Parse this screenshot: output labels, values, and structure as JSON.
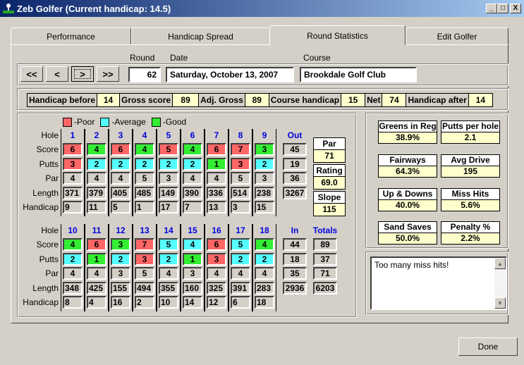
{
  "window": {
    "title": "Zeb Golfer (Current handicap: 14.5)",
    "minimize": "_",
    "maximize": "□",
    "close": "X"
  },
  "tabs": [
    {
      "label": "Performance",
      "active": false
    },
    {
      "label": "Handicap Spread",
      "active": false
    },
    {
      "label": "Round Statistics",
      "active": true
    },
    {
      "label": "Edit Golfer",
      "active": false
    }
  ],
  "nav": {
    "first": "<<",
    "prev": "<",
    "next": ">",
    "last": ">>"
  },
  "round": {
    "round_label": "Round",
    "round": "62",
    "date_label": "Date",
    "date": "Saturday, October 13, 2007",
    "course_label": "Course",
    "course": "Brookdale Golf Club"
  },
  "summary": [
    {
      "label": "Handicap before",
      "value": "14"
    },
    {
      "label": "Gross score",
      "value": "89"
    },
    {
      "label": "Adj. Gross",
      "value": "89"
    },
    {
      "label": "Course handicap",
      "value": "15"
    },
    {
      "label": "Net",
      "value": "74"
    },
    {
      "label": "Handicap after",
      "value": "14"
    }
  ],
  "legend": [
    {
      "label": "-Poor",
      "color": "#ff6666"
    },
    {
      "label": "-Average",
      "color": "#55ffff"
    },
    {
      "label": "-Good",
      "color": "#33ee33"
    }
  ],
  "row_labels": [
    "Hole",
    "Score",
    "Putts",
    "Par",
    "Length",
    "Handicap"
  ],
  "front": {
    "holes": [
      "1",
      "2",
      "3",
      "4",
      "5",
      "6",
      "7",
      "8",
      "9"
    ],
    "score": [
      "6",
      "4",
      "6",
      "4",
      "5",
      "4",
      "6",
      "7",
      "3"
    ],
    "score_rating": [
      "poor",
      "good",
      "poor",
      "good",
      "poor",
      "good",
      "poor",
      "poor",
      "good"
    ],
    "putts": [
      "3",
      "2",
      "2",
      "2",
      "2",
      "2",
      "1",
      "3",
      "2"
    ],
    "putts_rating": [
      "poor",
      "avg",
      "avg",
      "avg",
      "avg",
      "avg",
      "good",
      "poor",
      "avg"
    ],
    "par": [
      "4",
      "4",
      "4",
      "5",
      "3",
      "4",
      "4",
      "5",
      "3"
    ],
    "length": [
      "371",
      "379",
      "405",
      "485",
      "149",
      "390",
      "336",
      "514",
      "238"
    ],
    "handicap": [
      "9",
      "11",
      "5",
      "1",
      "17",
      "7",
      "13",
      "3",
      "15"
    ],
    "sum_label": "Out",
    "sums": [
      "45",
      "19",
      "36",
      "3267"
    ]
  },
  "back": {
    "holes": [
      "10",
      "11",
      "12",
      "13",
      "14",
      "15",
      "16",
      "17",
      "18"
    ],
    "score": [
      "4",
      "6",
      "3",
      "7",
      "5",
      "4",
      "6",
      "5",
      "4"
    ],
    "score_rating": [
      "good",
      "poor",
      "good",
      "poor",
      "avg",
      "avg",
      "poor",
      "avg",
      "good"
    ],
    "putts": [
      "2",
      "1",
      "2",
      "3",
      "2",
      "1",
      "3",
      "2",
      "2"
    ],
    "putts_rating": [
      "avg",
      "good",
      "avg",
      "poor",
      "avg",
      "good",
      "poor",
      "avg",
      "avg"
    ],
    "par": [
      "4",
      "4",
      "3",
      "5",
      "4",
      "3",
      "4",
      "4",
      "4"
    ],
    "length": [
      "348",
      "425",
      "155",
      "494",
      "355",
      "160",
      "325",
      "391",
      "283"
    ],
    "handicap": [
      "8",
      "4",
      "16",
      "2",
      "10",
      "14",
      "12",
      "6",
      "18"
    ],
    "sum_label": "In",
    "sums": [
      "44",
      "18",
      "35",
      "2936"
    ],
    "totals_label": "Totals",
    "totals": [
      "89",
      "37",
      "71",
      "6203"
    ]
  },
  "course_info": [
    {
      "label": "Par",
      "value": "71"
    },
    {
      "label": "Rating",
      "value": "69.0"
    },
    {
      "label": "Slope",
      "value": "115"
    }
  ],
  "stats": [
    {
      "label": "Greens in Reg",
      "value": "38.9%"
    },
    {
      "label": "Putts per hole",
      "value": "2.1"
    },
    {
      "label": "Fairways",
      "value": "64.3%"
    },
    {
      "label": "Avg Drive",
      "value": "195"
    },
    {
      "label": "Up & Downs",
      "value": "40.0%"
    },
    {
      "label": "Miss Hits",
      "value": "5.6%"
    },
    {
      "label": "Sand Saves",
      "value": "50.0%"
    },
    {
      "label": "Penalty %",
      "value": "2.2%"
    }
  ],
  "notes": "Too many miss hits!",
  "done_label": "Done"
}
